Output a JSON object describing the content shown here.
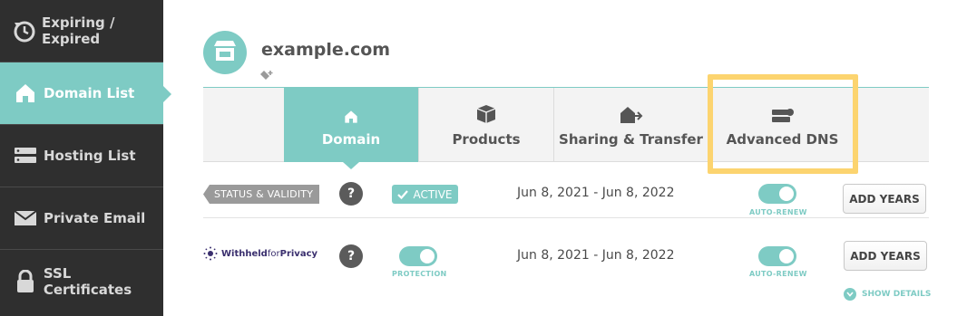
{
  "sidebar": {
    "items": [
      {
        "label": "Expiring / Expired",
        "icon": "expiring-clock-icon"
      },
      {
        "label": "Domain List",
        "icon": "home-icon",
        "active": true
      },
      {
        "label": "Hosting List",
        "icon": "server-icon"
      },
      {
        "label": "Private Email",
        "icon": "envelope-icon"
      },
      {
        "label": "SSL Certificates",
        "icon": "lock-icon"
      }
    ]
  },
  "header": {
    "domain": "example.com",
    "avatar_icon": "storefront-icon",
    "tag_icon": "add-tag-icon"
  },
  "tabs": [
    {
      "label": "Domain",
      "icon": "home-icon",
      "active": true
    },
    {
      "label": "Products",
      "icon": "box-icon"
    },
    {
      "label": "Sharing & Transfer",
      "icon": "house-arrow-icon"
    },
    {
      "label": "Advanced DNS",
      "icon": "dns-server-icon",
      "highlighted": true
    }
  ],
  "status_row": {
    "tag": "STATUS & VALIDITY",
    "help": "?",
    "badge": "ACTIVE",
    "dates": "Jun 8, 2021 - Jun 8, 2022",
    "toggle_label": "AUTO-RENEW",
    "toggle_on": true,
    "button": "ADD YEARS"
  },
  "privacy_row": {
    "logo_withheld": "Withheld",
    "logo_for": "for",
    "logo_privacy": "Privacy",
    "help": "?",
    "protection_label": "PROTECTION",
    "protection_on": true,
    "dates": "Jun 8, 2021 - Jun 8, 2022",
    "toggle_label": "AUTO-RENEW",
    "toggle_on": true,
    "button": "ADD YEARS",
    "show_details": "SHOW DETAILS"
  },
  "colors": {
    "accent": "#7ecbc4",
    "sidebar_bg": "#2f2f2f",
    "highlight": "#fcd46f"
  }
}
